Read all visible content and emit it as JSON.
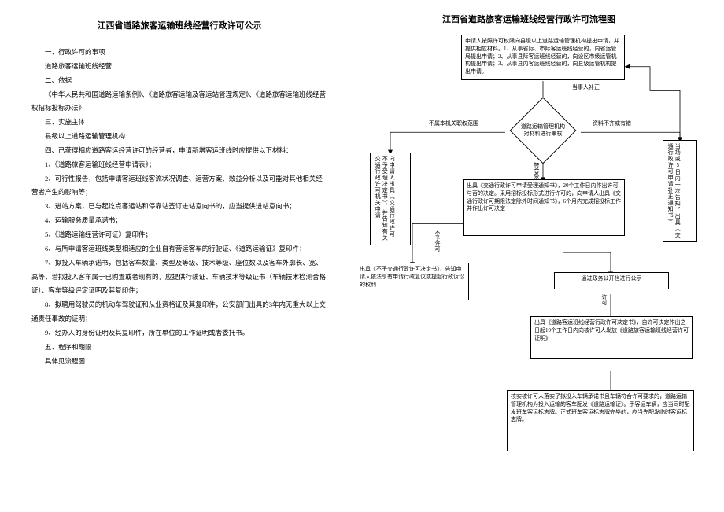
{
  "title": "江西省道路旅客运输班线经营行政许可公示",
  "sec1_h": "一、行政许可的事项",
  "sec1_l": "道路旅客运输班线经营",
  "sec2_h": "二、依据",
  "sec2_l": "《中华人民共和国道路运输条例》、《道路旅客运输及客运站管理规定》、《道路旅客运输班线经营权招标投标办法》",
  "sec3_h": "三、实施主体",
  "sec3_l": "县级以上道路运输管理机构",
  "sec4_h": "四、已获得相应道路客运经营许可的经营者，申请新增客运班线时应提供以下材料：",
  "m1": "1、《道路旅客运输班线经营申请表》；",
  "m2": "2、可行性报告，包括申请客运班线客流状况调查、运营方案、效益分析以及可能对其他相关经营者产生的影响等；",
  "m3": "3、进站方案，已与起讫点客运站和停靠站签订进站意向书的，应当提供进站意向书；",
  "m4": "4、运输服务质量承诺书；",
  "m5": "5、《道路运输经营许可证》复印件；",
  "m6": "6、与所申请客运班线类型相适应的企业自有营运客车的行驶证、《道路运输证》复印件；",
  "m7": "7、拟投入车辆承诺书，包括客车数量、类型及等级、技术等级、座位数以及客车外廓长、宽、高等，若拟投入客车属于已购置或者现有的，应提供行驶证、车辆技术等级证书（车辆技术检测合格证）、客车等级评定证明及其复印件；",
  "m8": "8、拟聘用驾驶员的机动车驾驶证和从业资格证及其复印件，公安部门出具的3年内无重大以上交通责任事故的证明；",
  "m9": "9、经办人的身份证明及其复印件，所在单位的工作证明或者委托书。",
  "sec5_h": "五、程序和期限",
  "sec5_l": "具体见流程图",
  "flowTitle": "江西省道路旅客运输班线经营行政许可流程图",
  "f_top": "申请人按照许可权限向县级以上道路运输管理机构提出申请，并提供相应材料。1、从事省际、市际客运班线经营的，向省运管局提出申请；2、从事县际客运班线经营的，向设区市级运管机构提出申请；3、从事县内客运班线经营的，向县级运管机构提出申请。",
  "d1a": "道路运输管理机构",
  "d1b": "对材料进行审核",
  "lbl_buzheng": "当事人补正",
  "lbl_notscope": "不属本机关职权范围",
  "lbl_badmat": "资料不齐或有错",
  "lbl_ok": "符合条件",
  "lbl_notallow": "不予许可",
  "lbl_allow": "许可",
  "f_left1": "向申请人出具《交通行政许可不予受理决定书》，并告知有关交通行政许可机关申请",
  "f_mid": "出具《交通行政许可申请受理通知书》，20个工作日内作出许可与否的决定。采用招标投标形式进行许可的，向申请人出具《交通行政许可期限法定除外时间通知书》，6个月内完成招投标工作并作出许可决定",
  "f_right1": "当场或5日内一次告知，出具《交通行政许可申请补正通知书》",
  "f_left2": "出具《不予交通行政许可决定书》，告知申请人依法享有申请行政复议或提起行政诉讼的权利",
  "f_pub": "通过政务公开栏进行公示",
  "f_dec": "出具《道路客运班线经营行政许可决定书》，自许可决定作出之日起10个工作日内向被许可人发放《道路旅客运输班线经营许可证明》",
  "f_final": "核实被许可人落实了拟投入车辆承诺书且车辆符合许可要求的，道路运输管理机构为投入运输的客车配发《道路运输证》。于客运车辆，应当同时配发班车客运标志牌。正式班车客运标志牌完毕的，应当先配发临时客运标志牌。",
  "chart_data": {
    "type": "flowchart",
    "nodes": [
      {
        "id": "apply",
        "shape": "rect",
        "text": "申请人按照许可权限向县级以上道路运输管理机构提出申请，并提供相应材料"
      },
      {
        "id": "review",
        "shape": "diamond",
        "text": "道路运输管理机构对材料进行审核"
      },
      {
        "id": "notscope",
        "shape": "rect",
        "text": "向申请人出具《交通行政许可不予受理决定书》"
      },
      {
        "id": "badmat",
        "shape": "rect",
        "text": "出具《交通行政许可申请补正通知书》"
      },
      {
        "id": "accept",
        "shape": "rect",
        "text": "出具《交通行政许可申请受理通知书》，作出许可与否的决定"
      },
      {
        "id": "deny",
        "shape": "rect",
        "text": "出具《不予交通行政许可决定书》"
      },
      {
        "id": "public",
        "shape": "rect",
        "text": "通过政务公开栏进行公示"
      },
      {
        "id": "decision",
        "shape": "rect",
        "text": "出具《道路客运班线经营行政许可决定书》"
      },
      {
        "id": "final",
        "shape": "rect",
        "text": "核实后配发《道路运输证》及客运标志牌"
      }
    ],
    "edges": [
      {
        "from": "apply",
        "to": "review"
      },
      {
        "from": "review",
        "to": "notscope",
        "label": "不属本机关职权范围"
      },
      {
        "from": "review",
        "to": "badmat",
        "label": "资料不齐或有错"
      },
      {
        "from": "badmat",
        "to": "apply",
        "label": "当事人补正"
      },
      {
        "from": "review",
        "to": "accept",
        "label": "符合条件"
      },
      {
        "from": "accept",
        "to": "deny",
        "label": "不予许可"
      },
      {
        "from": "accept",
        "to": "public"
      },
      {
        "from": "public",
        "to": "decision",
        "label": "许可"
      },
      {
        "from": "decision",
        "to": "final"
      }
    ]
  }
}
